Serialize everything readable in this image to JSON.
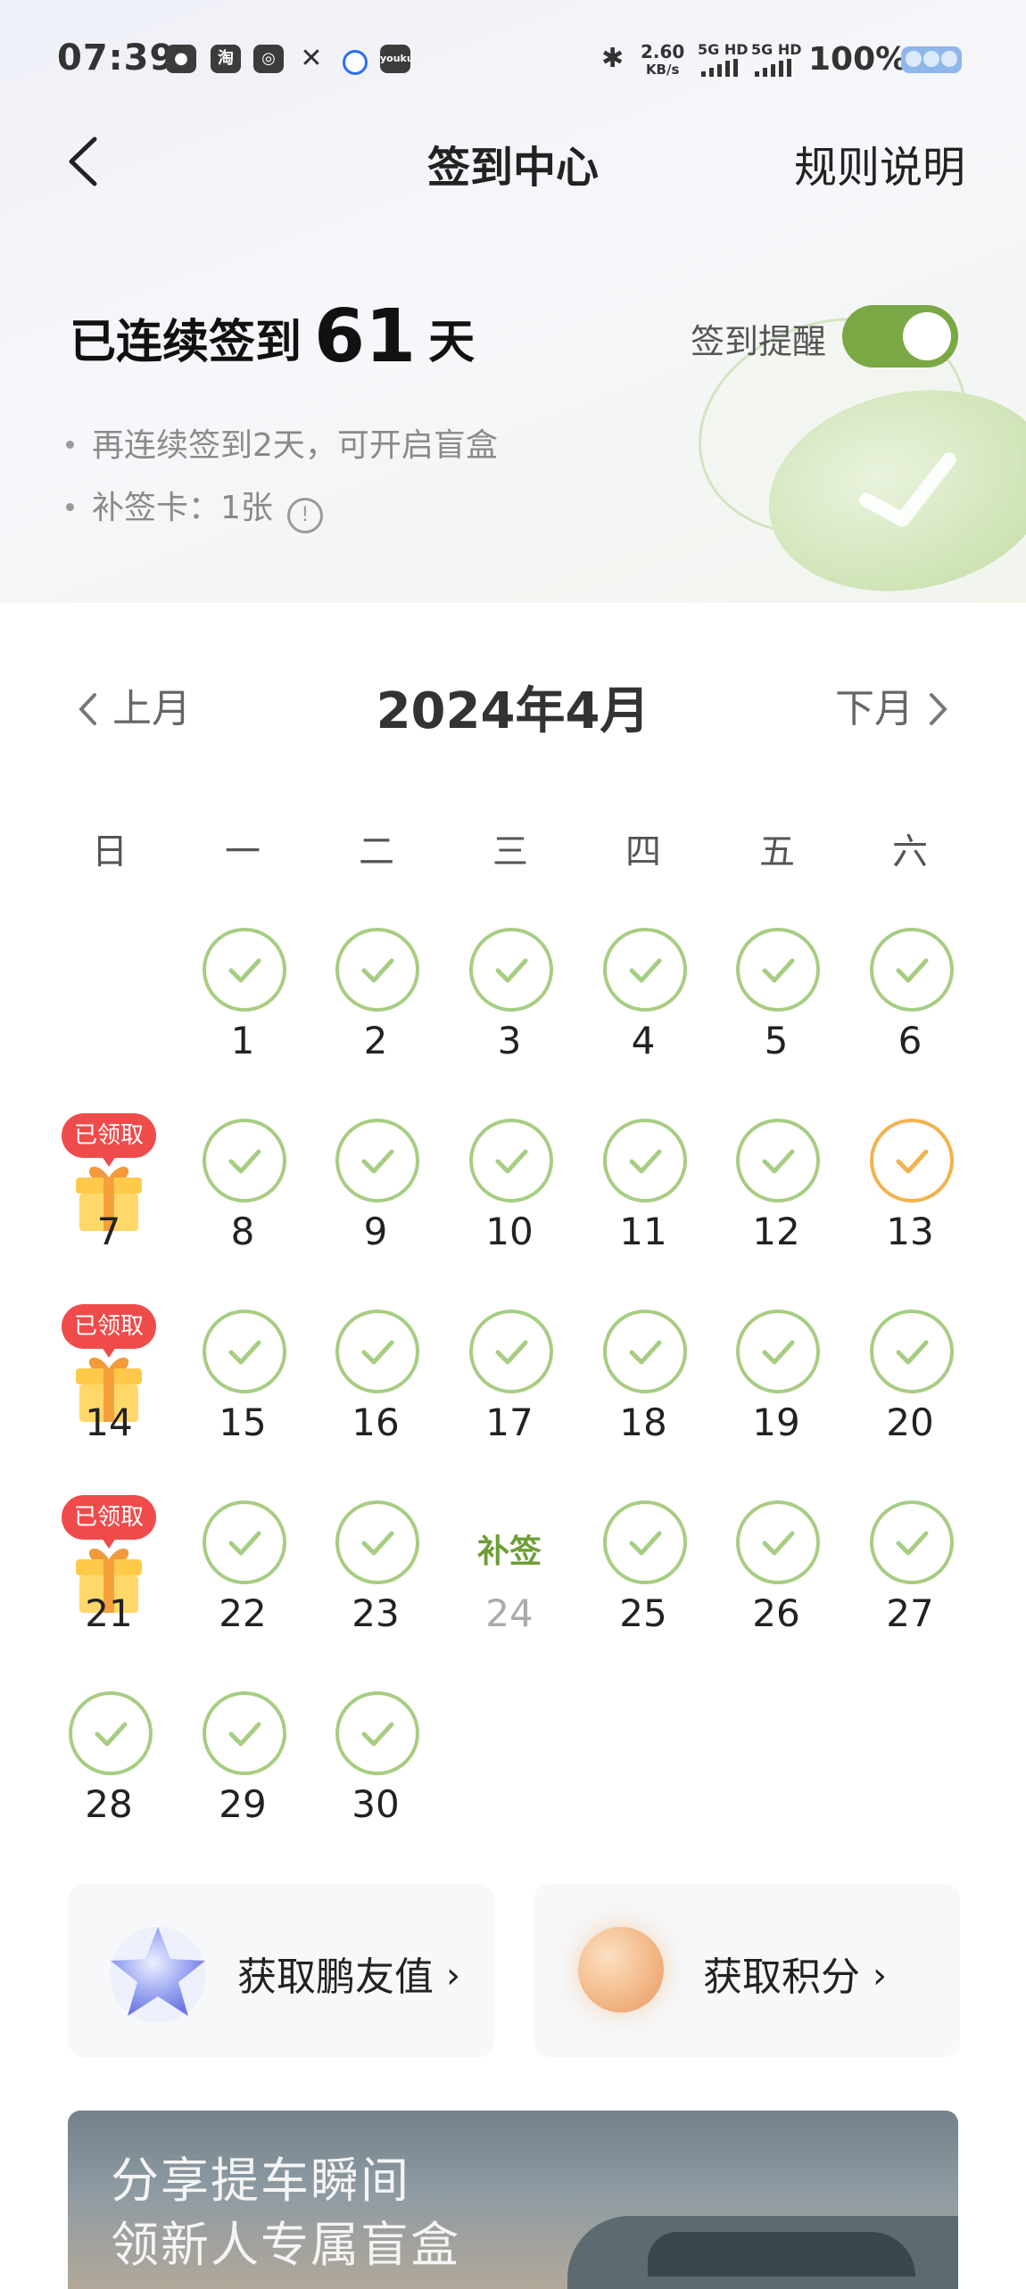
{
  "status_bar": {
    "time": "07:39",
    "app_icons": [
      "wechat-icon",
      "taobao-icon",
      "app-icon",
      "xpeng-icon",
      "browser-icon",
      "youku-icon"
    ],
    "youku_label": "youku",
    "taobao_label": "淘",
    "speed_value": "2.60",
    "speed_unit": "KB/s",
    "sim1": "5G HD",
    "sim2": "5G HD",
    "battery": "100%"
  },
  "header": {
    "title": "签到中心",
    "rules_link": "规则说明"
  },
  "summary": {
    "streak_prefix": "已连续签到",
    "streak_days": "61",
    "streak_suffix": "天",
    "reminder_label": "签到提醒",
    "reminder_on": true,
    "tip_blind_box": "再连续签到2天，可开启盲盒",
    "makeup_card_label": "补签卡：1张",
    "info_glyph": "!"
  },
  "calendar": {
    "prev_label": "上月",
    "next_label": "下月",
    "month_title": "2024年4月",
    "weekdays": [
      "日",
      "一",
      "二",
      "三",
      "四",
      "五",
      "六"
    ],
    "first_weekday": 1,
    "days": [
      {
        "day": "1",
        "state": "checked"
      },
      {
        "day": "2",
        "state": "checked"
      },
      {
        "day": "3",
        "state": "checked"
      },
      {
        "day": "4",
        "state": "checked"
      },
      {
        "day": "5",
        "state": "checked"
      },
      {
        "day": "6",
        "state": "checked"
      },
      {
        "day": "7",
        "state": "gift",
        "badge": "已领取"
      },
      {
        "day": "8",
        "state": "checked"
      },
      {
        "day": "9",
        "state": "checked"
      },
      {
        "day": "10",
        "state": "checked"
      },
      {
        "day": "11",
        "state": "checked"
      },
      {
        "day": "12",
        "state": "checked"
      },
      {
        "day": "13",
        "state": "today"
      },
      {
        "day": "14",
        "state": "gift",
        "badge": "已领取"
      },
      {
        "day": "15",
        "state": "checked"
      },
      {
        "day": "16",
        "state": "checked"
      },
      {
        "day": "17",
        "state": "checked"
      },
      {
        "day": "18",
        "state": "checked"
      },
      {
        "day": "19",
        "state": "checked"
      },
      {
        "day": "20",
        "state": "checked"
      },
      {
        "day": "21",
        "state": "gift",
        "badge": "已领取"
      },
      {
        "day": "22",
        "state": "checked"
      },
      {
        "day": "23",
        "state": "checked"
      },
      {
        "day": "24",
        "state": "missed",
        "action": "补签"
      },
      {
        "day": "25",
        "state": "checked"
      },
      {
        "day": "26",
        "state": "checked"
      },
      {
        "day": "27",
        "state": "checked"
      },
      {
        "day": "28",
        "state": "checked"
      },
      {
        "day": "29",
        "state": "checked"
      },
      {
        "day": "30",
        "state": "checked"
      }
    ],
    "colors": {
      "checked": "#a7cd82",
      "today": "#f2b24d",
      "makeup": "#6c9e36",
      "badge": "#f04b4b"
    }
  },
  "rewards": {
    "friend_value": "获取鹏友值",
    "points": "获取积分",
    "chevron": "›"
  },
  "banner": {
    "line1": "分享提车瞬间",
    "line2": "领新人专属盲盒"
  }
}
